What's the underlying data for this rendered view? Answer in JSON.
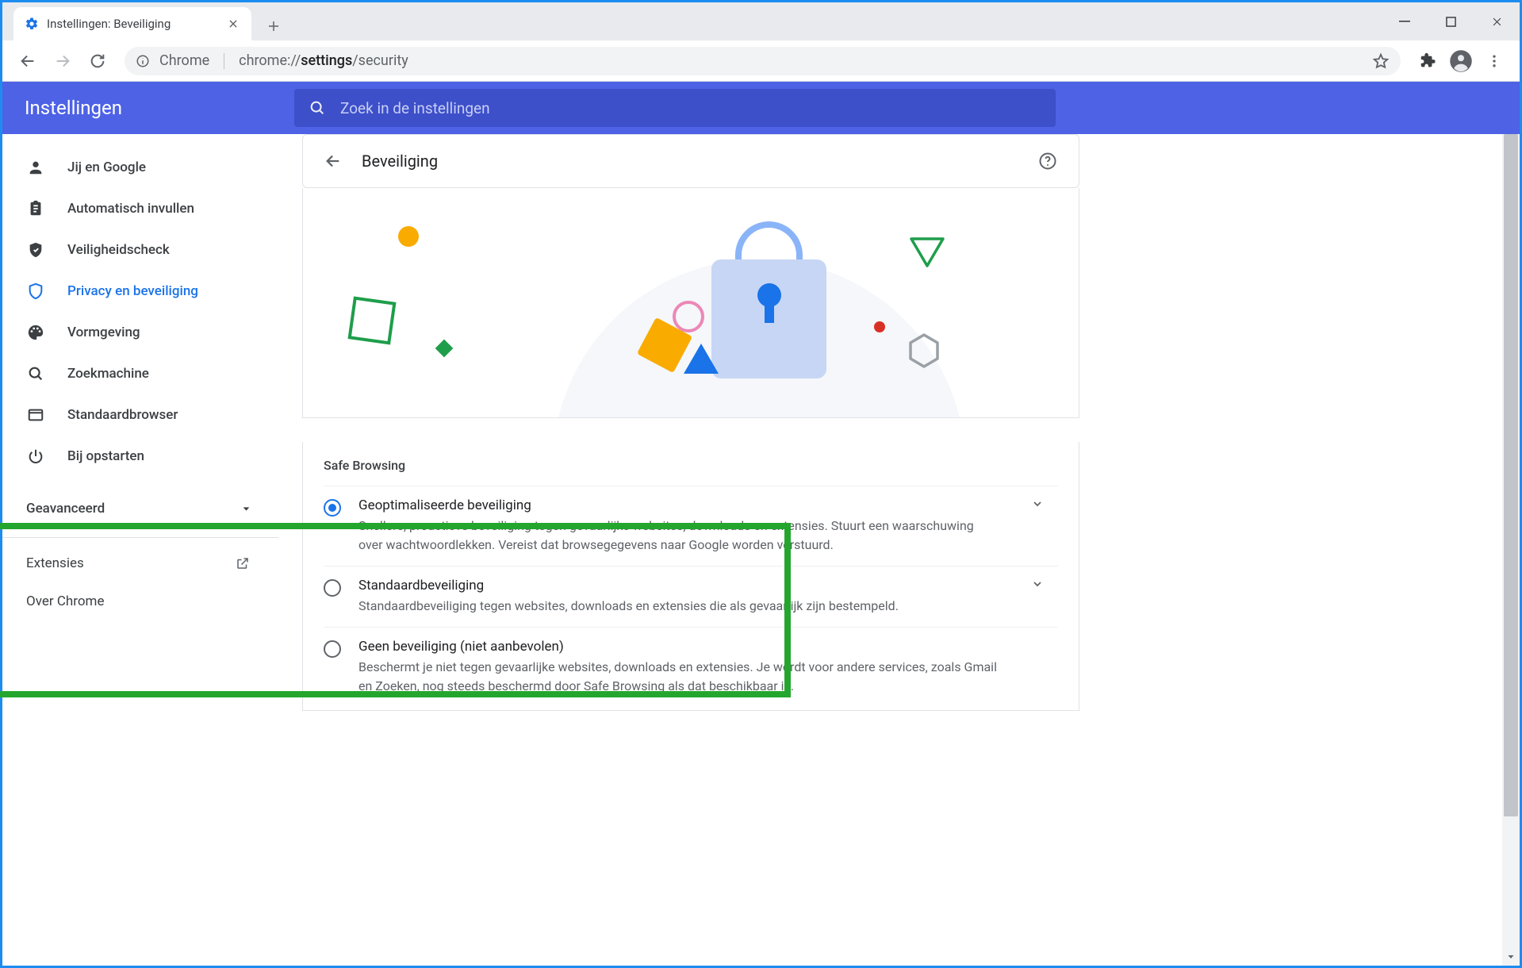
{
  "tab": {
    "title": "Instellingen: Beveiliging"
  },
  "omnibox": {
    "chip": "Chrome",
    "scheme": "chrome://",
    "host": "settings",
    "path": "/security"
  },
  "settings_header": {
    "title": "Instellingen",
    "search_placeholder": "Zoek in de instellingen"
  },
  "sidebar": {
    "items": [
      {
        "label": "Jij en Google"
      },
      {
        "label": "Automatisch invullen"
      },
      {
        "label": "Veiligheidscheck"
      },
      {
        "label": "Privacy en beveiliging"
      },
      {
        "label": "Vormgeving"
      },
      {
        "label": "Zoekmachine"
      },
      {
        "label": "Standaardbrowser"
      },
      {
        "label": "Bij opstarten"
      }
    ],
    "advanced": "Geavanceerd",
    "extensions": "Extensies",
    "about": "Over Chrome"
  },
  "page": {
    "title": "Beveiliging"
  },
  "safe_browsing": {
    "title": "Safe Browsing",
    "options": [
      {
        "title": "Geoptimaliseerde beveiliging",
        "desc": "Snellere, proactieve beveiliging tegen gevaarlijke websites, downloads en extensies. Stuurt een waarschuwing over wachtwoordlekken. Vereist dat browsegegevens naar Google worden verstuurd.",
        "checked": true,
        "expandable": true
      },
      {
        "title": "Standaardbeveiliging",
        "desc": "Standaardbeveiliging tegen websites, downloads en extensies die als gevaarlijk zijn bestempeld.",
        "checked": false,
        "expandable": true
      },
      {
        "title": "Geen beveiliging (niet aanbevolen)",
        "desc": "Beschermt je niet tegen gevaarlijke websites, downloads en extensies. Je wordt voor andere services, zoals Gmail en Zoeken, nog steeds beschermd door Safe Browsing als dat beschikbaar is.",
        "checked": false,
        "expandable": false
      }
    ]
  }
}
